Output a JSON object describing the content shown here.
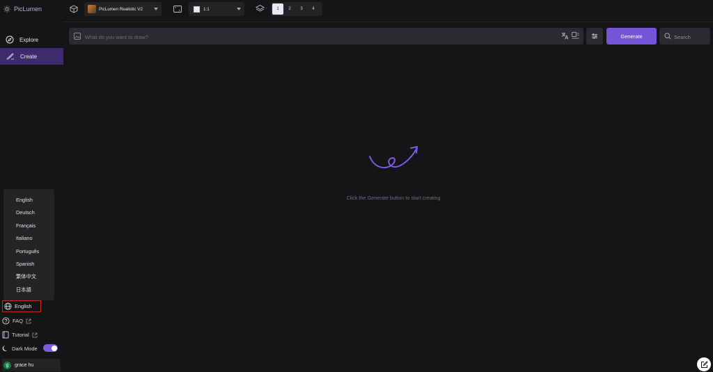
{
  "brand": {
    "name": "PicLumen"
  },
  "nav": [
    {
      "label": "Explore",
      "active": false
    },
    {
      "label": "Create",
      "active": true
    }
  ],
  "toolbar": {
    "model": "PicLumen Realistic V2",
    "ratio": "1:1",
    "counts": [
      "1",
      "2",
      "3",
      "4"
    ],
    "selected_count": "1"
  },
  "prompt": {
    "placeholder": "What do you want to draw?"
  },
  "generate_label": "Generate",
  "search": {
    "placeholder": "Search"
  },
  "empty_state": {
    "message": "Click the Generate button to start creating"
  },
  "language_menu": {
    "options": [
      "English",
      "Deutsch",
      "Français",
      "Italiano",
      "Português",
      "Spanish",
      "繁体中文",
      "日本語"
    ],
    "current": "English"
  },
  "links": {
    "faq": "FAQ",
    "tutorial": "Tutorial"
  },
  "dark_mode": {
    "label": "Dark Mode",
    "enabled": true
  },
  "user": {
    "initial": "g",
    "name": "grace hu"
  },
  "colors": {
    "accent": "#7654d9",
    "active_nav": "#3b2c6d",
    "highlight_border": "#d3262c",
    "background": "#151517"
  }
}
